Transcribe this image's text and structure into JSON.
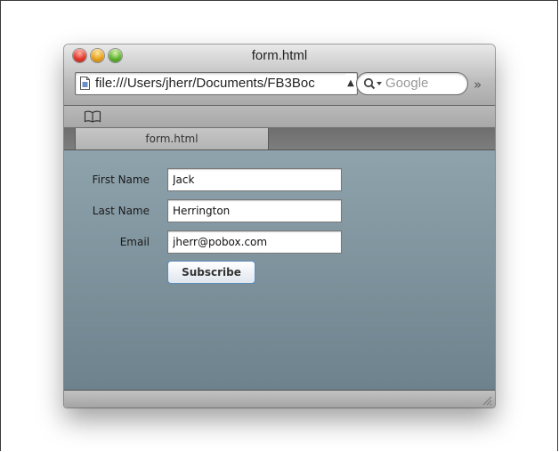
{
  "window": {
    "title": "form.html",
    "controls": [
      "close",
      "minimize",
      "zoom"
    ]
  },
  "toolbar": {
    "url": "file:///Users/jherr/Documents/FB3Boc",
    "search_placeholder": "Google",
    "overflow_glyph": "»",
    "bookmarks_icon": "book-icon"
  },
  "tabs": [
    {
      "label": "form.html",
      "active": true
    }
  ],
  "form": {
    "first_name_label": "First Name",
    "first_name_value": "Jack",
    "last_name_label": "Last Name",
    "last_name_value": "Herrington",
    "email_label": "Email",
    "email_value": "jherr@pobox.com",
    "submit_label": "Subscribe"
  },
  "colors": {
    "content_top": "#8fa3ad",
    "content_bottom": "#6d828c",
    "button_border": "#5b8bbd"
  }
}
